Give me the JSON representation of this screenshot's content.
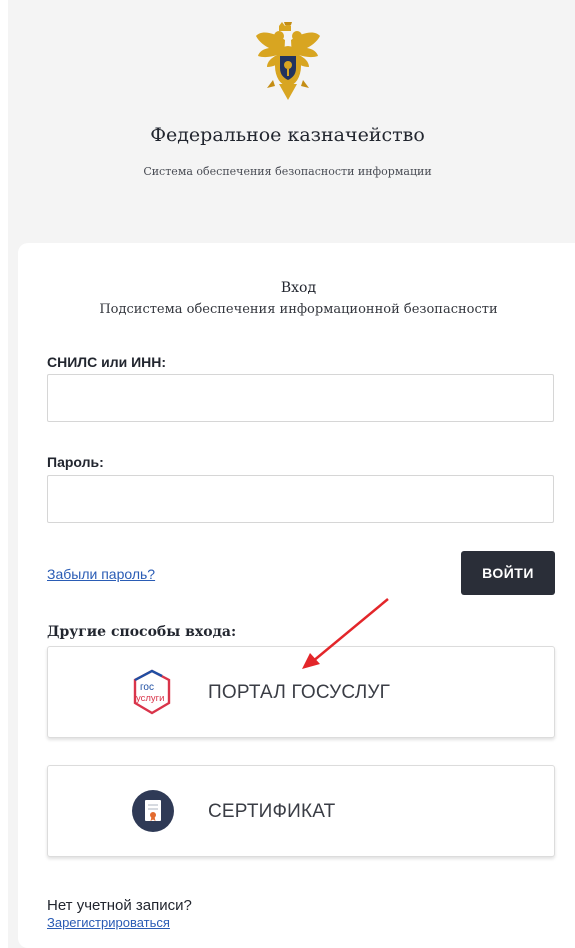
{
  "header": {
    "org_title": "Федеральное казначейство",
    "org_subtitle": "Система обеспечения безопасности информации",
    "emblem_icon": "double-headed-eagle-emblem"
  },
  "login": {
    "title": "Вход",
    "subtitle": "Подсистема обеспечения информационной безопасности",
    "snils_label": "СНИЛС или ИНН:",
    "snils_value": "",
    "password_label": "Пароль:",
    "password_value": "",
    "forgot_link": "Забыли пароль?",
    "submit_label": "ВОЙТИ"
  },
  "other_methods": {
    "label": "Другие способы входа:",
    "gosuslugi_label": "ПОРТАЛ ГОСУСЛУГ",
    "gosuslugi_logo_top": "гос",
    "gosuslugi_logo_bottom": "услуги",
    "certificate_label": "СЕРТИФИКАТ"
  },
  "footer": {
    "no_account": "Нет учетной записи?",
    "register_link": "Зарегистрироваться"
  },
  "colors": {
    "submit_bg": "#2a2e38",
    "link": "#2a5cb5",
    "gos_red": "#d9344a",
    "gos_blue": "#1f4fa3",
    "cert_circle": "#2f3a56",
    "annotation_arrow": "#e3262a",
    "emblem_gold": "#d8a521"
  }
}
